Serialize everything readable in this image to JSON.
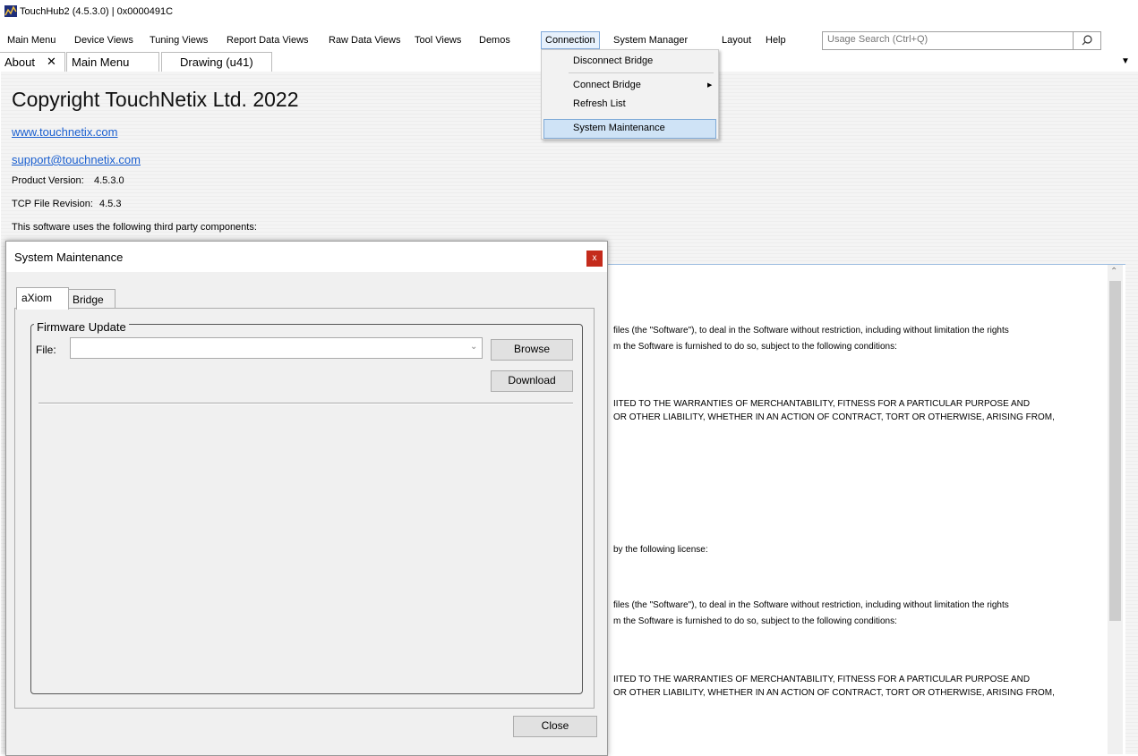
{
  "window": {
    "title": "TouchHub2 (4.5.3.0) | 0x0000491C"
  },
  "menubar": {
    "items": [
      "Main Menu",
      "Device Views",
      "Tuning Views",
      "Report Data Views",
      "Raw Data Views",
      "Tool Views",
      "Demos",
      "Connection",
      "System Manager",
      "Layout",
      "Help"
    ],
    "active": "Connection"
  },
  "search": {
    "placeholder": "Usage Search (Ctrl+Q)"
  },
  "doc_tabs": [
    {
      "label": "About",
      "close": "✕",
      "active": true
    },
    {
      "label": "Main Menu"
    },
    {
      "label": "Drawing (u41)"
    }
  ],
  "about": {
    "copyright": "Copyright TouchNetix Ltd. 2022",
    "website": "www.touchnetix.com",
    "support_email": "support@touchnetix.com",
    "product_version_label": "Product Version:",
    "product_version": "4.5.3.0",
    "tcp_revision_label": "TCP File Revision:",
    "tcp_revision": "4.5.3",
    "third_party_text": "This software uses the following third party components:"
  },
  "license_lines": [
    "files (the \"Software\"), to deal in the Software without restriction, including without limitation the rights",
    "m the Software is furnished to do so, subject to the following conditions:",
    "IITED TO THE WARRANTIES OF MERCHANTABILITY, FITNESS FOR A PARTICULAR PURPOSE AND",
    "OR OTHER LIABILITY, WHETHER IN AN ACTION OF CONTRACT, TORT OR OTHERWISE, ARISING FROM,",
    "by the following license:",
    "files (the \"Software\"), to deal in the Software without restriction, including without limitation the rights",
    "m the Software is furnished to do so, subject to the following conditions:",
    "IITED TO THE WARRANTIES OF MERCHANTABILITY, FITNESS FOR A PARTICULAR PURPOSE AND",
    "OR OTHER LIABILITY, WHETHER IN AN ACTION OF CONTRACT, TORT OR OTHERWISE, ARISING FROM,"
  ],
  "connection_menu": {
    "items": [
      "Disconnect Bridge",
      "Connect Bridge",
      "Refresh List",
      "System Maintenance"
    ],
    "highlighted": "System Maintenance"
  },
  "dialog": {
    "title": "System Maintenance",
    "close_x": "x",
    "tabs": [
      "aXiom",
      "Bridge"
    ],
    "active_tab": "aXiom",
    "group_title": "Firmware Update",
    "file_label": "File:",
    "file_value": "",
    "browse_label": "Browse",
    "download_label": "Download",
    "close_label": "Close"
  },
  "icons": {
    "app": "touchhub-logo-icon",
    "search": "search-icon",
    "close": "close-icon",
    "submenu": "chevron-right-icon",
    "combo": "chevron-down-icon",
    "tab_overflow": "chevron-down-icon"
  },
  "colors": {
    "accent": "#1a5fd0",
    "close_red": "#c42b1c",
    "menu_highlight": "#cfe3f6"
  }
}
